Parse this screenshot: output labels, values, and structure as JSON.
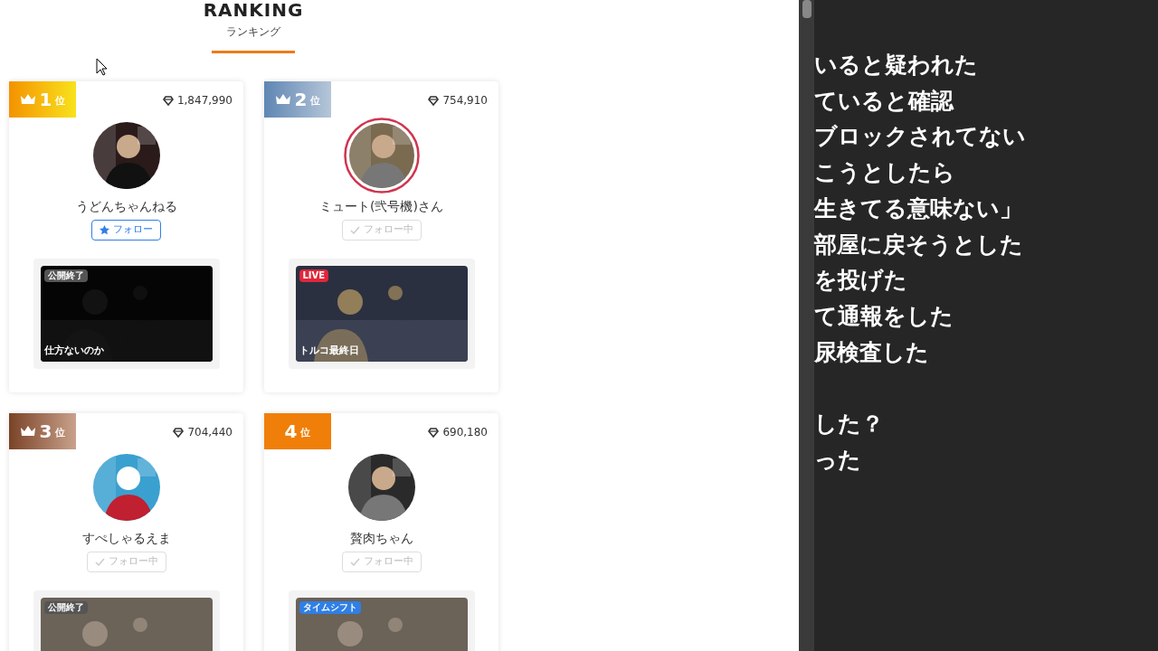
{
  "page": {
    "title": "RANKING",
    "subtitle": "ランキング"
  },
  "ranking": [
    {
      "rank": "1",
      "unit": "位",
      "badge": {
        "kind": "gold"
      },
      "crown": true,
      "points": "1,847,990",
      "name": "うどんちゃんねる",
      "ring": false,
      "following": false,
      "follow_label": "フォロー",
      "video": {
        "tag": {
          "text": "公開終了",
          "kind": "ended"
        },
        "caption": "仕方ないのか"
      }
    },
    {
      "rank": "2",
      "unit": "位",
      "badge": {
        "kind": "silver"
      },
      "crown": true,
      "points": "754,910",
      "name": "ミュート(弐号機)さん",
      "ring": true,
      "following": true,
      "follow_label": "フォロー中",
      "video": {
        "tag": {
          "text": "LIVE",
          "kind": "live"
        },
        "caption": "トルコ最終日"
      }
    },
    {
      "rank": "3",
      "unit": "位",
      "badge": {
        "kind": "bronze"
      },
      "crown": true,
      "points": "704,440",
      "name": "すぺしゃるえま",
      "ring": false,
      "following": true,
      "follow_label": "フォロー中",
      "video": {
        "tag": {
          "text": "公開終了",
          "kind": "ended"
        }
      }
    },
    {
      "rank": "4",
      "unit": "位",
      "badge": {
        "kind": "plain"
      },
      "crown": false,
      "points": "690,180",
      "name": "贅肉ちゃん",
      "ring": false,
      "following": true,
      "follow_label": "フォロー中",
      "video": {
        "tag": {
          "text": "タイムシフト",
          "kind": "timeshift"
        }
      }
    }
  ],
  "side_text": [
    "いると疑われた",
    "ていると確認",
    "ブロックされてない",
    "こうとしたら",
    "生きてる意味ない」",
    "部屋に戻そうとした",
    "を投げた",
    "て通報をした",
    "尿検査した"
  ],
  "side_text_2": [
    "した？",
    "った"
  ]
}
